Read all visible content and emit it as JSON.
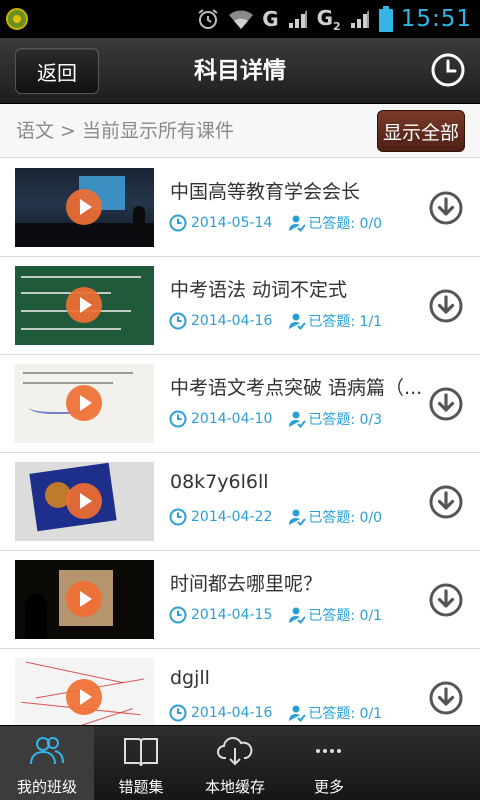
{
  "status_bar": {
    "network_1": "G",
    "network_2": "G",
    "network_2_sub": "2",
    "time": "15:51",
    "accent_color": "#33b5e5"
  },
  "header": {
    "back_label": "返回",
    "title": "科目详情",
    "history_icon": "clock-icon"
  },
  "breadcrumb": {
    "text": "语文 > 当前显示所有课件",
    "show_all_label": "显示全部"
  },
  "courses": [
    {
      "title": "中国高等教育学会会长",
      "date": "2014-05-14",
      "answered": "已答题: 0/0"
    },
    {
      "title": "中考语法 动词不定式",
      "date": "2014-04-16",
      "answered": "已答题: 1/1"
    },
    {
      "title": "中考语文考点突破 语病篇（...",
      "date": "2014-04-10",
      "answered": "已答题: 0/3"
    },
    {
      "title": "08k7y6l6ll",
      "date": "2014-04-22",
      "answered": "已答题: 0/0"
    },
    {
      "title": "时间都去哪里呢？",
      "date": "2014-04-15",
      "answered": "已答题: 0/1"
    },
    {
      "title": "dgjll",
      "date": "2014-04-16",
      "answered": "已答题: 0/1"
    }
  ],
  "bottom_nav": {
    "items": [
      {
        "label": "我的班级",
        "icon": "people-icon",
        "active": true
      },
      {
        "label": "错题集",
        "icon": "book-icon",
        "active": false
      },
      {
        "label": "本地缓存",
        "icon": "cloud-download-icon",
        "active": false
      },
      {
        "label": "更多",
        "icon": "more-icon",
        "active": false
      }
    ]
  },
  "colors": {
    "meta_blue": "#2a9fd6",
    "show_all_bg": "#5e2a1c",
    "play_orange": "#f06e32"
  }
}
